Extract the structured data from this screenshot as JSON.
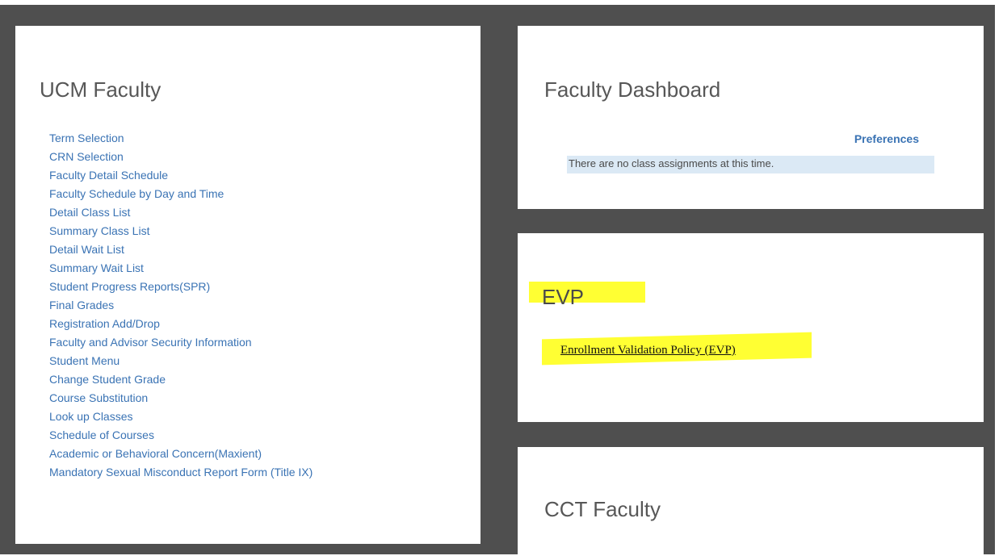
{
  "ucm": {
    "title": "UCM Faculty",
    "links": [
      "Term Selection",
      "CRN Selection",
      "Faculty Detail Schedule",
      "Faculty Schedule by Day and Time",
      "Detail Class List",
      "Summary Class List",
      "Detail Wait List",
      "Summary Wait List",
      "Student Progress Reports(SPR)",
      "Final Grades",
      "Registration Add/Drop",
      "Faculty and Advisor Security Information",
      "Student Menu",
      "Change Student Grade",
      "Course Substitution",
      "Look up Classes",
      "Schedule of Courses",
      "Academic or Behavioral Concern(Maxient)",
      "Mandatory Sexual Misconduct Report Form (Title IX)"
    ]
  },
  "dashboard": {
    "title": "Faculty Dashboard",
    "preferences_label": "Preferences",
    "message": "There are no class assignments at this time."
  },
  "evp": {
    "title": "EVP",
    "link_label": "Enrollment Validation Policy (EVP)",
    "highlight_color": "#ffff33"
  },
  "cct": {
    "title": "CCT Faculty"
  },
  "colors": {
    "frame": "#4f4f4f",
    "link": "#3a73b4",
    "title": "#575757",
    "info_row": "#dbe9f5"
  }
}
